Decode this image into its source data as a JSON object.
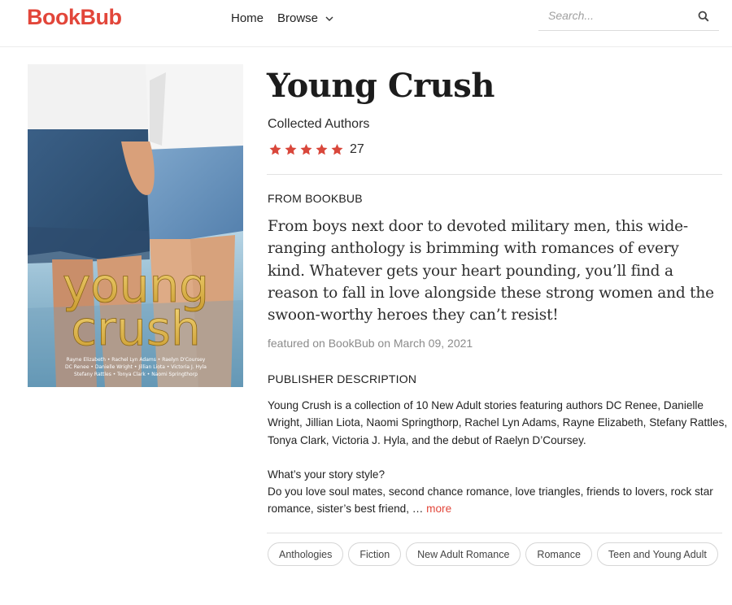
{
  "header": {
    "logo": "BookBub",
    "nav": {
      "home": "Home",
      "browse": "Browse"
    },
    "search": {
      "placeholder": "Search..."
    }
  },
  "book": {
    "title": "Young Crush",
    "author": "Collected Authors",
    "rating": {
      "stars": 5,
      "count": "27"
    },
    "cover": {
      "title_line1": "young",
      "title_line2": "crush",
      "authors_line1": "Rayne Elizabeth • Rachel Lyn Adams • Raelyn D'Coursey",
      "authors_line2": "DC Renee • Danielle Wright • Jillian Liota • Victoria J. Hyla",
      "authors_line3": "Stefany Rattles • Tonya Clark • Naomi Springthorp"
    }
  },
  "from_bookbub": {
    "label": "FROM BOOKBUB",
    "blurb": "From boys next door to devoted military men, this wide-ranging anthology is brimming with romances of every kind. Whatever gets your heart pounding, you’ll find a reason to fall in love alongside these strong women and the swoon-worthy heroes they can’t resist!",
    "featured": "featured on BookBub on March 09, 2021"
  },
  "publisher": {
    "label": "PUBLISHER DESCRIPTION",
    "para1": "Young Crush is a collection of 10 New Adult stories featuring authors DC Renee, Danielle Wright, Jillian Liota, Naomi Springthorp, Rachel Lyn Adams, Rayne Elizabeth, Stefany Rattles, Tonya Clark, Victoria J. Hyla, and the debut of Raelyn D’Coursey.",
    "para2_line1": "What’s your story style?",
    "para2_line2": "Do you love soul mates, second chance romance, love triangles, friends to lovers, rock star romance, sister’s best friend, … ",
    "more": "more"
  },
  "tags": [
    "Anthologies",
    "Fiction",
    "New Adult Romance",
    "Romance",
    "Teen and Young Adult"
  ],
  "colors": {
    "brand": "#e2463a",
    "star": "#d9473b"
  }
}
